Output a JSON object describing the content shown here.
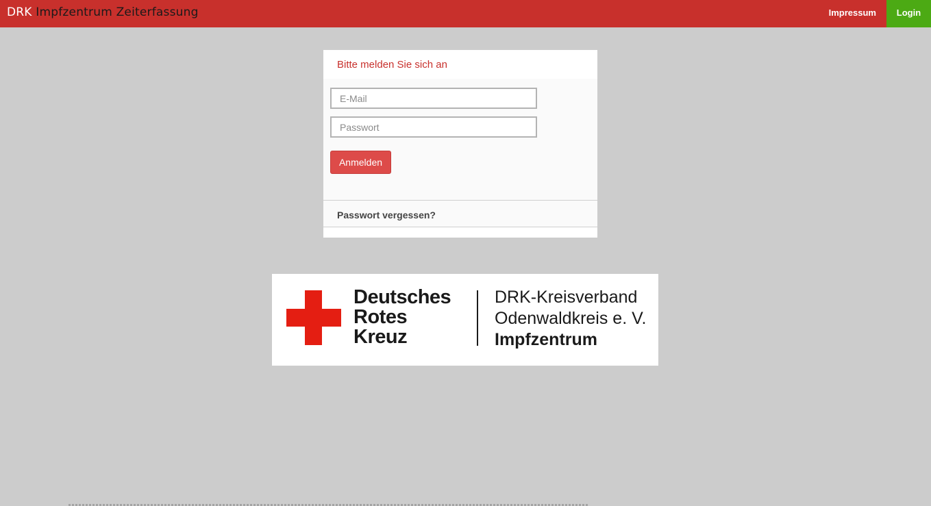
{
  "navbar": {
    "brand_prefix": "DRK",
    "brand_suffix": "Impfzentrum Zeiterfassung",
    "impressum_label": "Impressum",
    "login_label": "Login",
    "colors": {
      "bar": "#c8302c",
      "login": "#4caa14"
    }
  },
  "login_panel": {
    "heading": "Bitte melden Sie sich an",
    "email": {
      "value": "",
      "placeholder": "E-Mail"
    },
    "password": {
      "value": "",
      "placeholder": "Passwort"
    },
    "submit_label": "Anmelden",
    "forgot_label": "Passwort vergessen?"
  },
  "logo": {
    "name_lines": [
      "Deutsches",
      "Rotes",
      "Kreuz"
    ],
    "org_lines": [
      "DRK-Kreisverband",
      "Odenwaldkreis e. V.",
      "Impfzentrum"
    ],
    "icon": "red-cross-icon",
    "cross_color": "#e41e12"
  }
}
